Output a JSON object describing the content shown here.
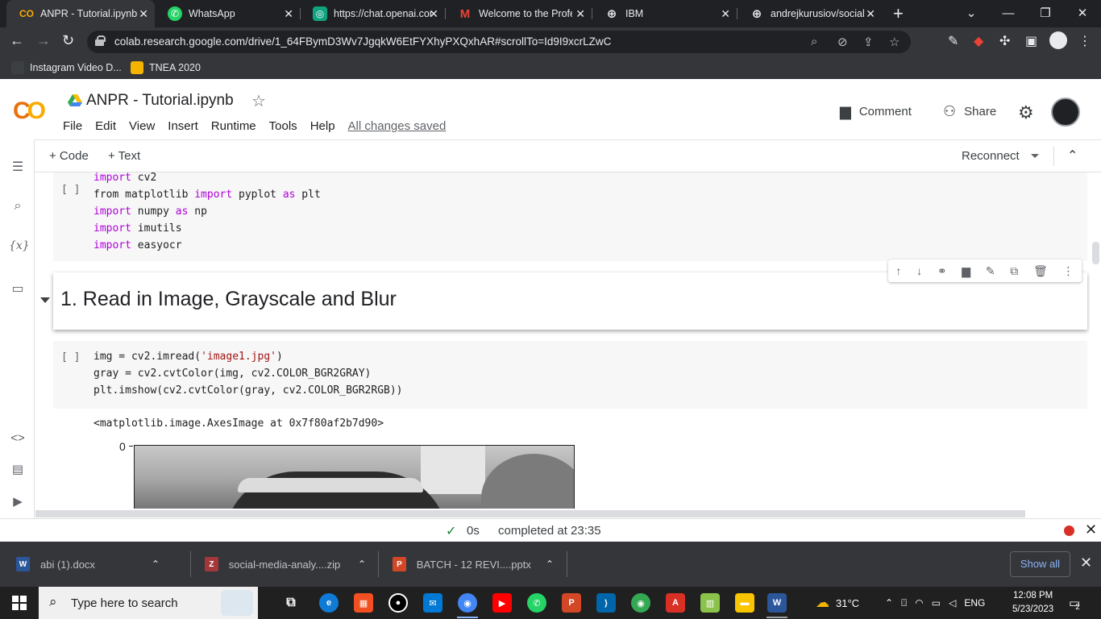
{
  "browser": {
    "tabs": [
      {
        "title": "ANPR - Tutorial.ipynb",
        "icon": "colab-icon",
        "active": true
      },
      {
        "title": "WhatsApp",
        "icon": "whatsapp-icon",
        "active": false
      },
      {
        "title": "https://chat.openai.com",
        "icon": "openai-icon",
        "active": false
      },
      {
        "title": "Welcome to the Profe",
        "icon": "gmail-icon",
        "active": false
      },
      {
        "title": "IBM",
        "icon": "globe-icon",
        "active": false
      },
      {
        "title": "andrejkurusiov/social-",
        "icon": "globe-icon",
        "active": false
      }
    ],
    "url": "colab.research.google.com/drive/1_64FBymD3Wv7JgqkW6EtFYXhyPXQxhAR#scrollTo=Id9I9xcrLZwC",
    "bookmarks": [
      {
        "label": "Instagram Video D..."
      },
      {
        "label": "TNEA 2020"
      }
    ]
  },
  "colab": {
    "notebook_title": "ANPR - Tutorial.ipynb",
    "menu": [
      "File",
      "Edit",
      "View",
      "Insert",
      "Runtime",
      "Tools",
      "Help"
    ],
    "save_status": "All changes saved",
    "comment_label": "Comment",
    "share_label": "Share",
    "add_code_label": "+ Code",
    "add_text_label": "+ Text",
    "reconnect_label": "Reconnect"
  },
  "cells": {
    "imports_bracket": "[ ]",
    "imports_code": [
      "import cv2",
      "from matplotlib import pyplot as plt",
      "import numpy as np",
      "import imutils",
      "import easyocr"
    ],
    "heading": "1. Read in Image, Grayscale and Blur",
    "read_bracket": "[ ]",
    "read_code": [
      "img = cv2.imread('image1.jpg')",
      "gray = cv2.cvtColor(img, cv2.COLOR_BGR2GRAY)",
      "plt.imshow(cv2.cvtColor(gray, cv2.COLOR_BGR2RGB))"
    ],
    "output": "<matplotlib.image.AxesImage at 0x7f80af2b7d90>",
    "plot_tick_label": "0"
  },
  "status": {
    "elapsed": "0s",
    "message": "completed at 23:35"
  },
  "downloads": {
    "items": [
      {
        "name": "abi (1).docx",
        "icon": "word-icon",
        "color": "#2b579a"
      },
      {
        "name": "social-media-analy....zip",
        "icon": "zip-icon",
        "color": "#a4373a"
      },
      {
        "name": "BATCH - 12  REVI....pptx",
        "icon": "powerpoint-icon",
        "color": "#d24726"
      }
    ],
    "show_all": "Show all"
  },
  "taskbar": {
    "search_placeholder": "Type here to search",
    "weather": "31°C",
    "language": "ENG",
    "time": "12:08 PM",
    "date": "5/23/2023",
    "notifications": "2"
  }
}
